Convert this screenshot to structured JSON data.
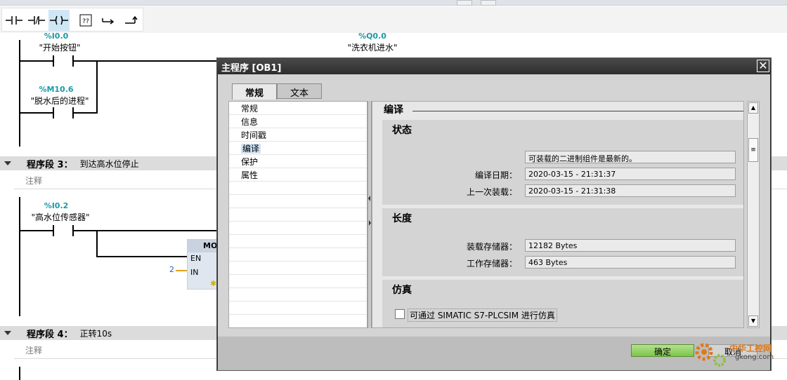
{
  "toolbar": {
    "buttons": [
      {
        "icon": "normally-open-contact-icon"
      },
      {
        "icon": "normally-closed-contact-icon"
      },
      {
        "icon": "output-coil-icon"
      },
      {
        "icon": "empty-box-icon",
        "label": "??"
      },
      {
        "icon": "open-branch-icon"
      },
      {
        "icon": "close-branch-icon"
      }
    ]
  },
  "ladder": {
    "rung1": {
      "contact1": {
        "address": "%I0.0",
        "symbol": "\"开始按钮\""
      },
      "contact2": {
        "address": "%M10.6",
        "symbol": "\"脱水后的进程\""
      },
      "coil": {
        "address": "%Q0.0",
        "symbol": "\"洗衣机进水\""
      }
    },
    "segment3": {
      "title": "程序段 3：",
      "name": "到达高水位停止",
      "comment": "注释"
    },
    "rung3": {
      "contact": {
        "address": "%I0.2",
        "symbol": "\"高水位传感器\""
      },
      "box": {
        "header": "MO",
        "en": "EN",
        "in": "IN",
        "in_value": "2",
        "star": "✱"
      }
    },
    "segment4": {
      "title": "程序段 4：",
      "name": "正转10s",
      "comment": "注释"
    }
  },
  "dialog": {
    "title": "主程序 [OB1]",
    "close": "✕",
    "tabs": [
      "常规",
      "文本"
    ],
    "nav": [
      "常规",
      "信息",
      "时间戳",
      "编译",
      "保护",
      "属性"
    ],
    "selected_nav": "编译",
    "section": "编译",
    "status": {
      "title": "状态",
      "message": "可装载的二进制组件是最新的。",
      "compile_date_label": "编译日期：",
      "compile_date": "2020-03-15 - 21:31:37",
      "last_load_label": "上一次装载：",
      "last_load": "2020-03-15 - 21:31:38"
    },
    "length": {
      "title": "长度",
      "load_memory_label": "装载存储器：",
      "load_memory": "12182 Bytes",
      "work_memory_label": "工作存储器：",
      "work_memory": "463 Bytes"
    },
    "simulation": {
      "title": "仿真",
      "checkbox_label": "可通过 SIMATIC S7-PLCSIM 进行仿真",
      "checked": false
    },
    "ok": "确定",
    "cancel": "取消"
  },
  "watermark": {
    "line1": "中华工控网",
    "line2": "gkong.com"
  },
  "colors": {
    "address": "#1a9aa6",
    "ok_button": "#7cc54a",
    "dialog_title": "#2f2f2f",
    "watermark": "#e0791a"
  }
}
